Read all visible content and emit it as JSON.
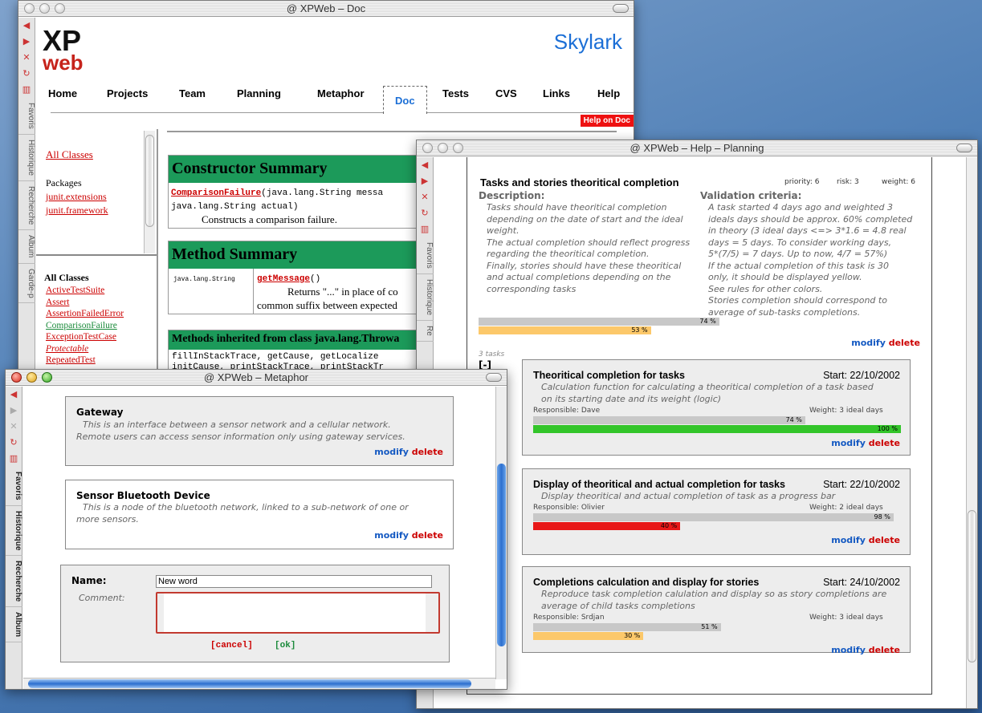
{
  "doc_window": {
    "title": "@ XPWeb – Doc",
    "logo_top": "XP",
    "logo_bottom": "web",
    "project_name": "Skylark",
    "nav": [
      "Home",
      "Projects",
      "Team",
      "Planning",
      "Metaphor",
      "Doc",
      "Tests",
      "CVS",
      "Links",
      "Help"
    ],
    "active_nav": "Doc",
    "help_badge": "Help on Doc",
    "sidebar_tabs": [
      "Favoris",
      "Historique",
      "Recherche",
      "Album",
      "Garde-p"
    ],
    "left_top": {
      "all_classes": "All Classes",
      "packages_label": "Packages",
      "packages": [
        "junit.extensions",
        "junit.framework"
      ]
    },
    "left_bottom": {
      "heading": "All Classes",
      "classes": [
        "ActiveTestSuite",
        "Assert",
        "AssertionFailedError",
        "ComparisonFailure",
        "ExceptionTestCase",
        "Protectable",
        "RepeatedTest"
      ]
    },
    "constructor_summary": {
      "heading": "Constructor Summary",
      "sig_name": "ComparisonFailure",
      "sig_args": "(java.lang.String messa",
      "sig_args2": "java.lang.String actual)",
      "desc": "Constructs a comparison failure."
    },
    "method_summary": {
      "heading": "Method Summary",
      "return_type": "java.lang.String",
      "name": "getMessage",
      "parens": "()",
      "desc1": "Returns \"...\" in place of co",
      "desc2": "common suffix between expected"
    },
    "inherited": {
      "heading": "Methods inherited from class java.lang.Throwa",
      "line1": "fillInStackTrace, getCause, getLocalize",
      "line2": "initCause, printStackTrace, printStackTr"
    }
  },
  "planning_window": {
    "title": "@ XPWeb – Help – Planning",
    "sidebar_tabs": [
      "Favoris",
      "Historique",
      "Re"
    ],
    "story": {
      "title": "Tasks and stories theoritical completion",
      "priority": "priority: 6",
      "risk": "risk: 3",
      "weight": "weight: 6",
      "desc_label": "Description:",
      "desc_lines": [
        "Tasks should have theoritical completion",
        "depending on the date of start and the ideal",
        "weight.",
        "The actual completion should reflect progress",
        "regarding the theoritical completion.",
        "Finally, stories should have these theoritical",
        "and actual completions depending on the",
        "corresponding tasks"
      ],
      "val_label": "Validation criteria:",
      "val_lines": [
        "A task started 4 days ago and weighted 3",
        "ideals days should be approx. 60% completed",
        "in theory (3 ideal days <=> 3*1.6 = 4.8 real",
        "days = 5 days. To consider working days,",
        "5*(7/5) = 7 days. Up to now, 4/7 = 57%)",
        "If the actual completion of this task is 30",
        "only, it should be displayed yellow.",
        "See rules for other colors.",
        "Stories completion should correspond to",
        "average of sub-tasks completions."
      ],
      "theoretical_pct": 74,
      "theoretical_label": "74 %",
      "actual_pct": 53,
      "actual_label": "53 %",
      "modify": "modify",
      "delete": "delete",
      "tasks_count": "3 tasks",
      "collapse": "[-]"
    },
    "tasks": [
      {
        "title": "Theoritical completion for tasks",
        "start": "Start: 22/10/2002",
        "desc": [
          "Calculation function for calculating a theoritical completion of a task based",
          "on its starting date and its weight (logic)"
        ],
        "responsible": "Responsible: Dave",
        "weight": "Weight: 3 ideal days",
        "theo": 74,
        "theo_label": "74 %",
        "act": 100,
        "act_label": "100 %",
        "act_color": "#33c52a",
        "modify": "modify",
        "delete": "delete"
      },
      {
        "title": "Display of theoritical and actual completion for tasks",
        "start": "Start: 22/10/2002",
        "desc": [
          "Display theoritical and actual completion of task as a progress bar"
        ],
        "responsible": "Responsible: Olivier",
        "weight": "Weight: 2 ideal days",
        "theo": 98,
        "theo_label": "98 %",
        "act": 40,
        "act_label": "40 %",
        "act_color": "#e81818",
        "modify": "modify",
        "delete": "delete"
      },
      {
        "title": "Completions calculation and display for stories",
        "start": "Start: 24/10/2002",
        "desc": [
          "Reproduce task completion calulation and display so as story completions are",
          "average of child tasks completions"
        ],
        "responsible": "Responsible: Srdjan",
        "weight": "Weight: 3 ideal days",
        "theo": 51,
        "theo_label": "51 %",
        "act": 30,
        "act_label": "30 %",
        "act_color": "#fcc86a",
        "modify": "modify",
        "delete": "delete"
      }
    ]
  },
  "metaphor_window": {
    "title": "@ XPWeb – Metaphor",
    "sidebar_tabs": [
      "Favoris",
      "Historique",
      "Recherche",
      "Album"
    ],
    "entries": [
      {
        "name": "Gateway",
        "desc": [
          "This is an interface between a sensor network and a cellular network.",
          "Remote users can access sensor information only using gateway services."
        ],
        "modify": "modify",
        "delete": "delete"
      },
      {
        "name": "Sensor Bluetooth Device",
        "desc": [
          "This is a node of the bluetooth network, linked to a sub-network of one or",
          "more sensors."
        ],
        "modify": "modify",
        "delete": "delete"
      }
    ],
    "form": {
      "name_label": "Name:",
      "name_value": "New word",
      "comment_label": "Comment:",
      "comment_value": "",
      "cancel": "[cancel]",
      "ok": "[ok]"
    }
  }
}
